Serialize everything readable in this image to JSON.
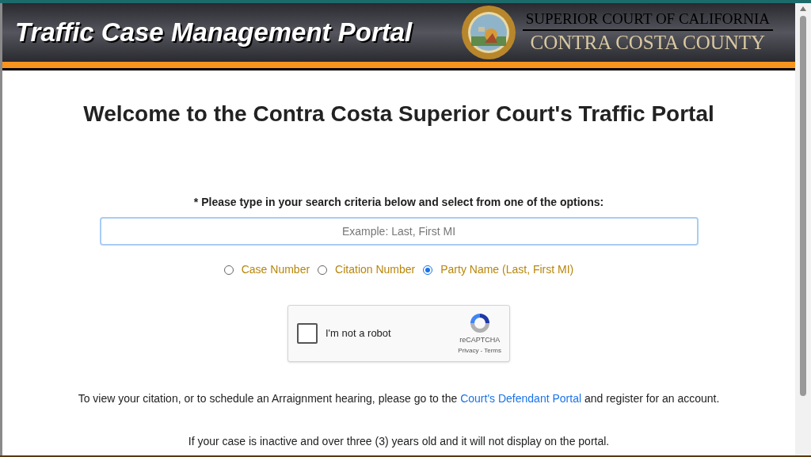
{
  "header": {
    "title": "Traffic Case Management Portal",
    "court_line_1": "SUPERIOR COURT OF CALIFORNIA",
    "court_line_2": "CONTRA COSTA COUNTY"
  },
  "heading": "Welcome to the Contra Costa Superior Court's Traffic Portal",
  "search": {
    "label": "* Please type in your search criteria below and select from one of the options:",
    "placeholder": "Example: Last, First MI"
  },
  "options": [
    {
      "label": "Case Number",
      "selected": false
    },
    {
      "label": "Citation Number",
      "selected": false
    },
    {
      "label": "Party Name (Last, First MI)",
      "selected": true
    }
  ],
  "captcha": {
    "label": "I'm not a robot",
    "checked": false,
    "brand": "reCAPTCHA",
    "privacy": "Privacy",
    "separator": "-",
    "terms": "Terms"
  },
  "info": {
    "before": "To view your citation, or to schedule an Arraignment hearing, please go to the",
    "link": "Court's Defendant Portal",
    "after": "and register for an account."
  },
  "notice": "If your case is inactive and over three (3) years old and it will not display on the portal."
}
